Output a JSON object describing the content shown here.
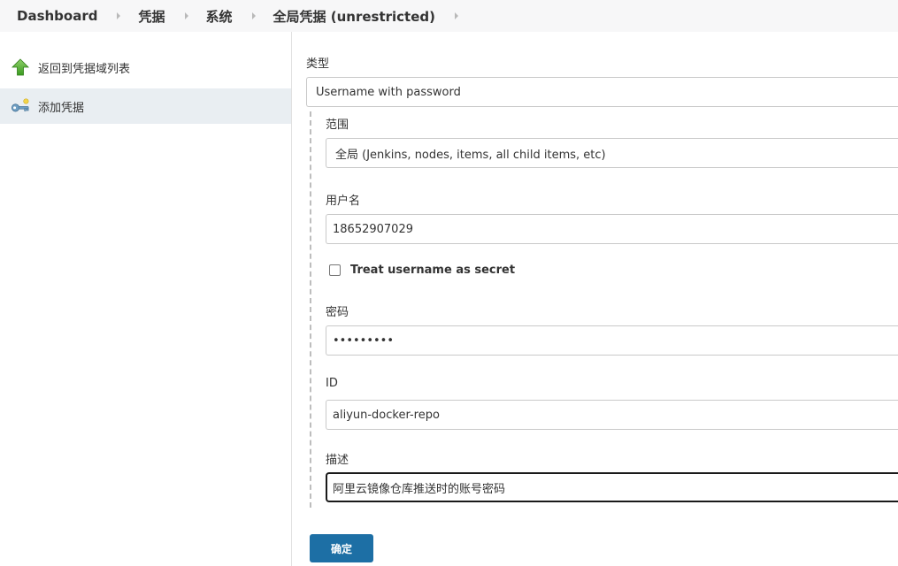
{
  "breadcrumb": {
    "items": [
      "Dashboard",
      "凭据",
      "系统",
      "全局凭据 (unrestricted)"
    ]
  },
  "sidebar": {
    "items": [
      {
        "label": "返回到凭据域列表",
        "icon": "green-up-arrow-icon"
      },
      {
        "label": "添加凭据",
        "icon": "key-icon"
      }
    ]
  },
  "form": {
    "kind_label": "类型",
    "kind_value": "Username with password",
    "scope_label": "范围",
    "scope_value": "全局 (Jenkins, nodes, items, all child items, etc)",
    "username_label": "用户名",
    "username_value": "18652907029",
    "treat_secret_label": "Treat username as secret",
    "password_label": "密码",
    "password_value": "•••••••••",
    "id_label": "ID",
    "id_value": "aliyun-docker-repo",
    "description_label": "描述",
    "description_value": "阿里云镜像仓库推送时的账号密码",
    "ok_label": "确定"
  },
  "colors": {
    "accent": "#1d6fa5",
    "breadcrumb_bg": "#f7f7f8",
    "selected_item_bg": "#e9eef2"
  }
}
